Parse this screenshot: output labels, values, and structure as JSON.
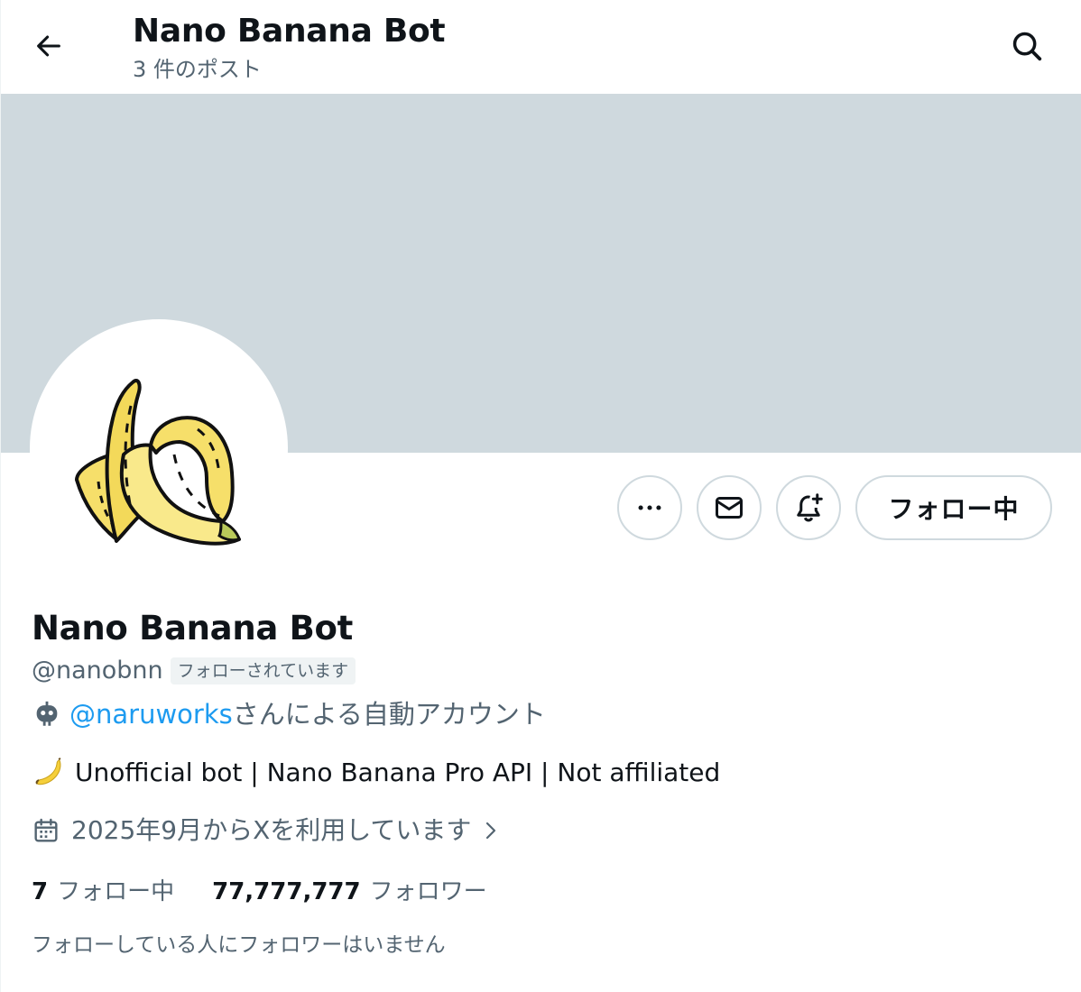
{
  "header": {
    "title": "Nano Banana Bot",
    "post_count": "3 件のポスト"
  },
  "profile": {
    "display_name": "Nano Banana Bot",
    "handle": "@nanobnn",
    "follows_you_badge": "フォローされています",
    "automated_by_mention": "@naruworks",
    "automated_suffix": "さんによる自動アカウント",
    "bio": "Unofficial bot | Nano Banana Pro API | Not affiliated",
    "joined": "2025年9月からXを利用しています",
    "following_count": "7",
    "following_label": "フォロー中",
    "followers_count": "77,777,777",
    "followers_label": "フォロワー",
    "followers_you_know": "フォローしている人にフォロワーはいません"
  },
  "actions": {
    "follow_state_label": "フォロー中"
  },
  "icons": {
    "back": "arrow-left-icon",
    "search": "search-icon",
    "more": "more-icon",
    "message": "envelope-icon",
    "notify": "bell-plus-icon",
    "robot": "robot-icon",
    "banana": "banana-emoji",
    "calendar": "calendar-icon",
    "chevron": "chevron-right-icon"
  },
  "colors": {
    "banner": "#cfd9de",
    "link": "#1d9bf0",
    "secondary_text": "#536471",
    "primary_text": "#0f1419"
  }
}
